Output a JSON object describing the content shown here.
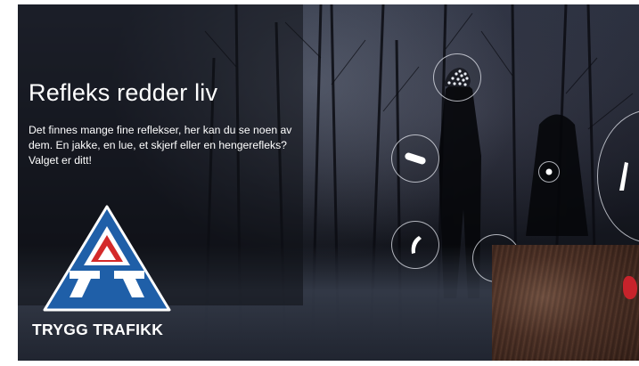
{
  "hero": {
    "title": "Refleks redder liv",
    "description": "Det finnes mange fine reflekser, her kan du se noen av dem. En jakke, en lue, et skjerf eller en hengerefleks? Valget er ditt!"
  },
  "brand": {
    "name": "TRYGG TRAFIKK",
    "logo_colors": {
      "blue": "#1f5fa8",
      "red": "#d42a2a",
      "white": "#ffffff"
    }
  },
  "hotspots": [
    {
      "id": "hat",
      "icon": "knit-hat-reflector-icon"
    },
    {
      "id": "hanger",
      "icon": "pill-reflector-icon"
    },
    {
      "id": "band",
      "icon": "curved-band-reflector-icon"
    },
    {
      "id": "dark",
      "icon": "dark-hotspot-icon"
    },
    {
      "id": "scarf-dot",
      "icon": "dot-reflector-icon"
    },
    {
      "id": "jacket",
      "icon": "jacket-reflector-icon"
    }
  ],
  "video": {
    "label": ""
  }
}
